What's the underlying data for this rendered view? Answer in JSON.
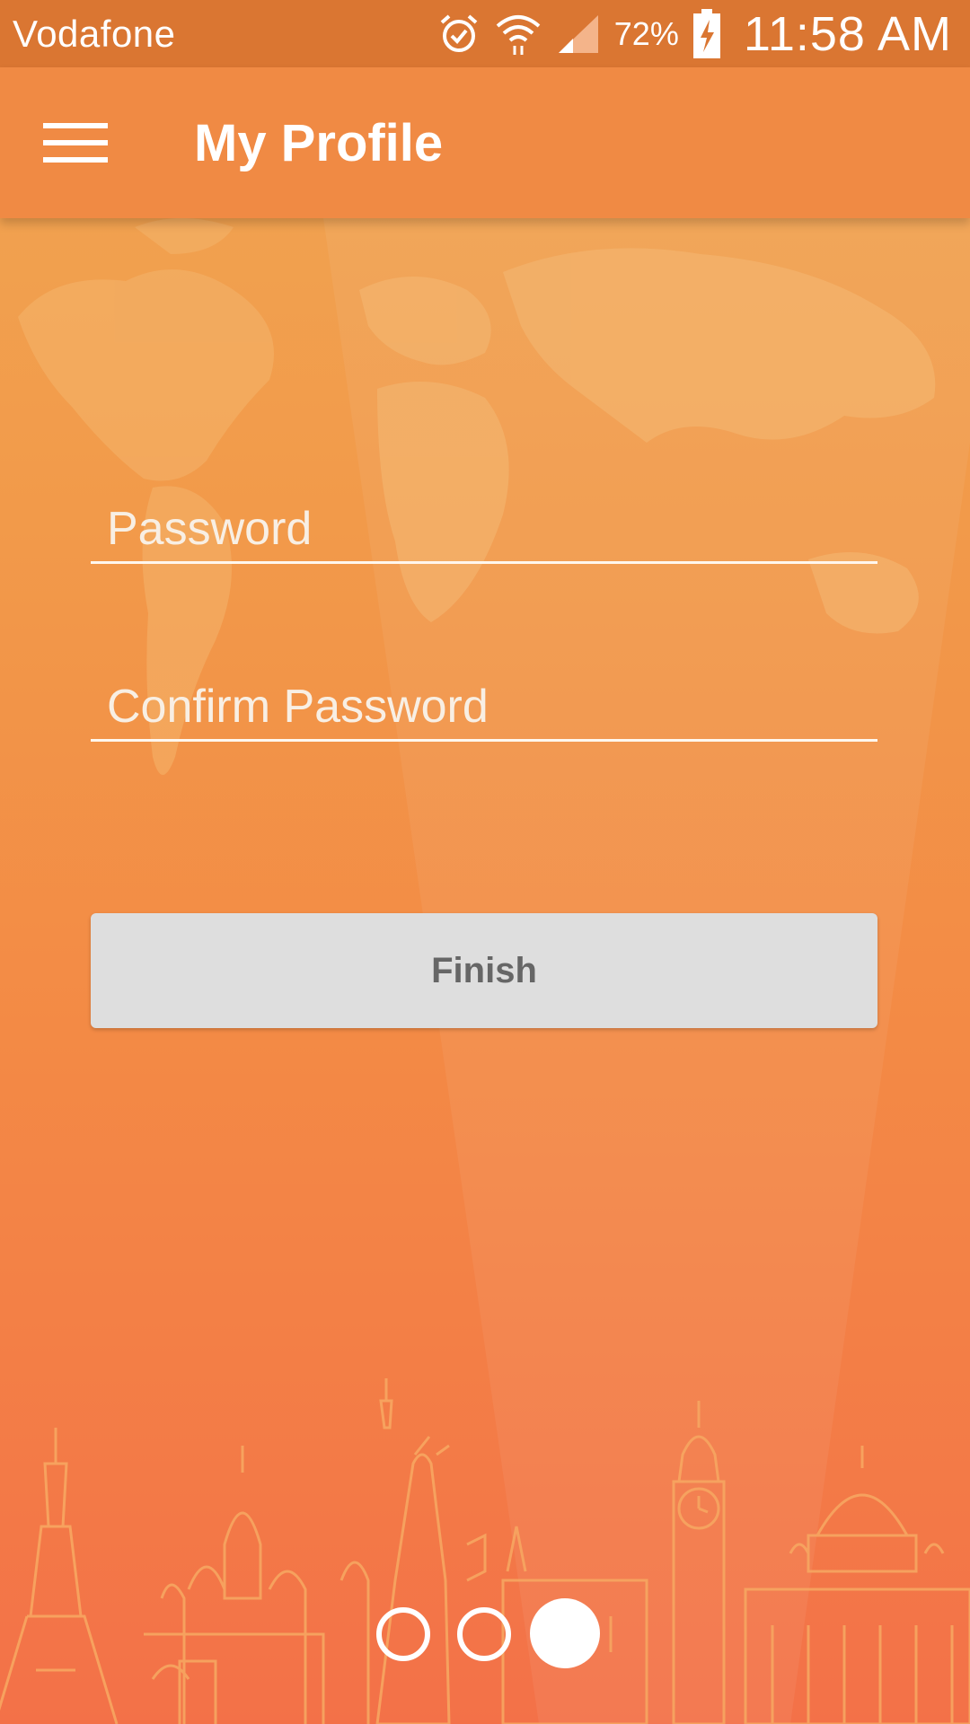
{
  "status_bar": {
    "carrier": "Vodafone",
    "battery_percent": "72%",
    "time": "11:58 AM",
    "icons": [
      "alarm-icon",
      "wifi-icon",
      "signal-icon",
      "battery-charging-icon"
    ]
  },
  "app_bar": {
    "menu_icon": "hamburger-menu-icon",
    "title": "My Profile"
  },
  "form": {
    "password": {
      "placeholder": "Password",
      "value": ""
    },
    "confirm_password": {
      "placeholder": "Confirm Password",
      "value": ""
    },
    "finish_label": "Finish"
  },
  "pager": {
    "total_pages": 3,
    "current_page": 3
  },
  "colors": {
    "status_bar": "#da7632",
    "app_bar": "#f08a44",
    "background_top": "#f0a653",
    "background_bottom": "#f37148",
    "button_bg": "#dedede",
    "button_text": "#666666"
  }
}
